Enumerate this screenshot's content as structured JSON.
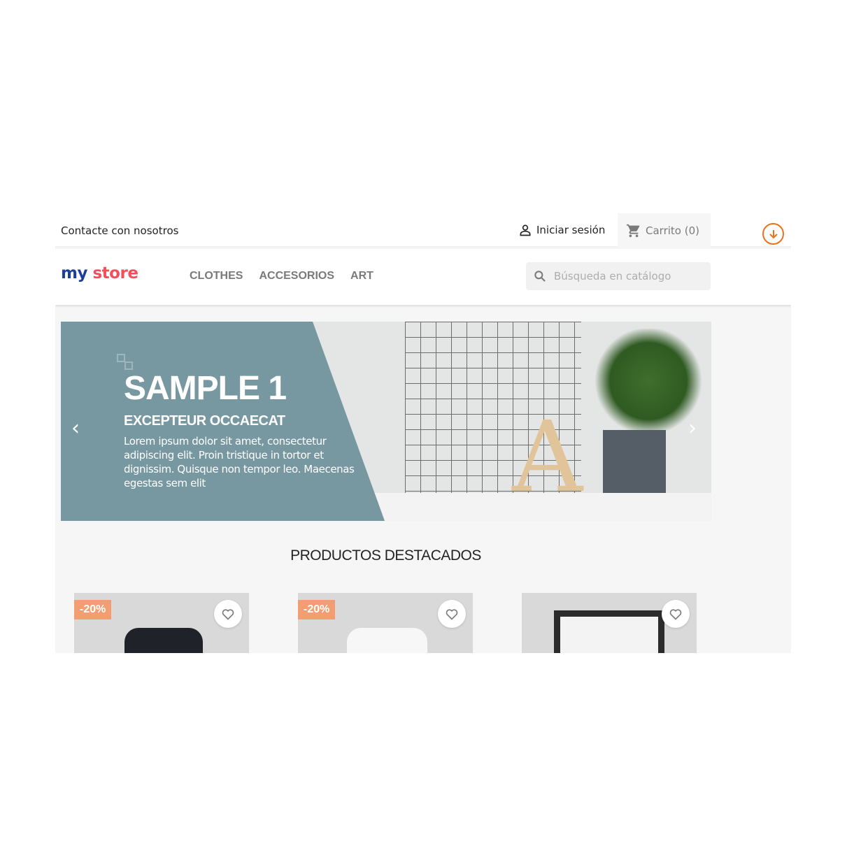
{
  "topbar": {
    "contact": "Contacte con nosotros",
    "login": "Iniciar sesión",
    "cart": "Carrito (0)"
  },
  "header": {
    "logo": {
      "my": "my",
      "store": "store"
    },
    "nav": [
      "CLOTHES",
      "ACCESORIOS",
      "ART"
    ],
    "search_placeholder": "Búsqueda en catálogo"
  },
  "slider": {
    "title": "SAMPLE 1",
    "subtitle": "EXCEPTEUR OCCAECAT",
    "text": "Lorem ipsum dolor sit amet, consectetur adipiscing elit. Proin tristique in tortor et dignissim. Quisque non tempor leo. Maecenas egestas sem elit"
  },
  "featured": {
    "title": "PRODUCTOS DESTACADOS",
    "products": [
      {
        "badge": "-20%"
      },
      {
        "badge": "-20%"
      },
      {
        "badge": ""
      }
    ]
  },
  "colors": {
    "accent": "#e8731f",
    "slide_panel": "#7797a1",
    "badge": "#f39d72"
  }
}
